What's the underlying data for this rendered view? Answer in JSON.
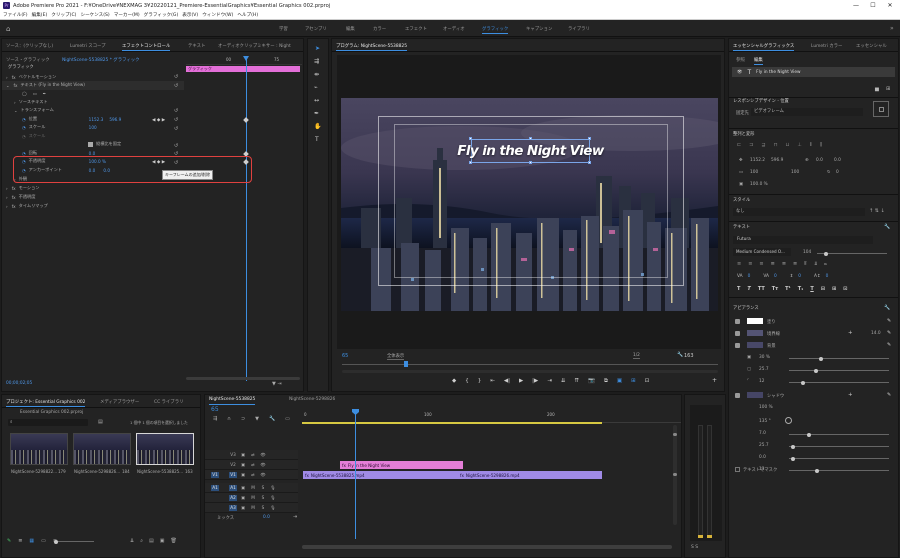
{
  "window": {
    "title": "Adobe Premiere Pro 2021 - F:¥OneDrive¥NEXMAG 3¥20220121_Premiere-EssentialGraphics¥Essential Graphics 002.prproj",
    "minimize": "—",
    "maximize": "☐",
    "close": "✕"
  },
  "menu": [
    "ファイル(F)",
    "編集(E)",
    "クリップ(C)",
    "シーケンス(S)",
    "マーカー(M)",
    "グラフィック(G)",
    "表示(V)",
    "ウィンドウ(W)",
    "ヘルプ(H)"
  ],
  "workspaces": {
    "items": [
      "学習",
      "アセンブリ",
      "編集",
      "カラー",
      "エフェクト",
      "オーディオ",
      "グラフィック",
      "キャプション",
      "ライブラリ"
    ],
    "active": "グラフィック"
  },
  "effectControls": {
    "tabs": [
      "ソース：(クリップなし)",
      "Lumetri スコープ",
      "エフェクトコントロール",
      "テキスト",
      "オーディオクリップミキサー : Night"
    ],
    "activeTab": "エフェクトコントロール",
    "master": "ソース・グラフィック",
    "sequence": "NightScene-5538825 * グラフィック",
    "header": "グラフィック",
    "ruler": [
      "00",
      "75"
    ],
    "clipBar": "グラフィック",
    "rows": [
      {
        "label": "ベクトルモーション",
        "indent": 1
      },
      {
        "label": "テキスト (Fly in the Night View)",
        "indent": 1
      },
      {
        "label": "ソーステキスト",
        "indent": 2
      },
      {
        "label": "トランスフォーム",
        "indent": 2
      },
      {
        "label": "位置",
        "v1": "1152.3",
        "v2": "596.9",
        "indent": 3
      },
      {
        "label": "スケール",
        "v1": "100",
        "v2": "",
        "indent": 3
      },
      {
        "label": "スケール",
        "v1": "",
        "v2": "",
        "indent": 3
      },
      {
        "label": "",
        "v1": "縦横比を固定",
        "v2": "",
        "indent": 3
      },
      {
        "label": "回転",
        "v1": "0.0",
        "v2": "",
        "indent": 3
      },
      {
        "label": "不透明度",
        "v1": "100.0 %",
        "v2": "",
        "indent": 3
      },
      {
        "label": "アンカーポイント",
        "v1": "0.0",
        "v2": "0.0",
        "indent": 3
      },
      {
        "label": "外観",
        "v1": "",
        "v2": "",
        "indent": 1
      },
      {
        "label": "モーション",
        "indent": 1
      },
      {
        "label": "不透明度",
        "indent": 1
      },
      {
        "label": "タイムリマップ",
        "indent": 1
      }
    ],
    "tooltip": "キーフレームの追加/削除",
    "timecode": "00;00;02;05"
  },
  "program": {
    "tabTitle": "プログラム: NightScene-5538825",
    "overlayTitle": "Fly in the Night View",
    "timecode": "65",
    "fit": "全体表示",
    "quality": "1/2",
    "duration": "163",
    "colors": {
      "sky": "#3c3a52",
      "title": "#ffffff"
    }
  },
  "essentialGraphics": {
    "tabs": [
      "エッセンシャルグラフィックス",
      "Lumetri カラー",
      "エッセンシャル"
    ],
    "subtabs": [
      "参照",
      "編集"
    ],
    "activeSub": "編集",
    "layer": "Fly in the Night View",
    "responsive": "レスポンシブデザイン - 位置",
    "pin": "固定先",
    "pinValue": "ビデオフレーム",
    "alignSection": "整列と変形",
    "pos": [
      "1152.2",
      "596.9"
    ],
    "anchor": [
      "0.0",
      "0.0"
    ],
    "scale": "100",
    "rot": "0",
    "opacity": "100.0 %",
    "styleLabel": "スタイル",
    "styleValue": "なし",
    "textLabel": "テキスト",
    "font": "Futura",
    "fontStyle": "Medium Condensed O...",
    "fontSize": "104",
    "tracking": [
      "0",
      "0",
      "0",
      "0"
    ],
    "appearance": "アピアランス",
    "fill": "塗り",
    "stroke": "境界線",
    "background": "背景",
    "shadow": "シャドウ",
    "strokeVal": "14.0",
    "bgVals": [
      "30 %",
      "25.7",
      "12"
    ],
    "shadowVals": [
      "135 °",
      "100 %",
      "7.0",
      "25.7",
      "0.0",
      "13"
    ],
    "textMask": "テキストでマスク"
  },
  "project": {
    "tabs": [
      "プロジェクト: Essential Graphics 002",
      "メディアブラウザー",
      "CC ライブラリ"
    ],
    "file": "Essential Graphics 002.prproj",
    "selection": "1 個中 1 個の項目を選択しました",
    "clips": [
      {
        "name": "NightScene-5298822...",
        "dur": "179"
      },
      {
        "name": "NightScene-5298826...",
        "dur": "184"
      },
      {
        "name": "NightScene-5538825...",
        "dur": "163"
      }
    ]
  },
  "timeline": {
    "tabs": [
      "NightScene-5538825",
      "NightScene-5298826"
    ],
    "timecode": "65",
    "ruler": [
      "0",
      "100",
      "200"
    ],
    "tracks": [
      {
        "name": "V3",
        "type": "video"
      },
      {
        "name": "V2",
        "type": "video"
      },
      {
        "name": "V1",
        "type": "video"
      },
      {
        "name": "A1",
        "type": "audio"
      },
      {
        "name": "A2",
        "type": "audio"
      },
      {
        "name": "A3",
        "type": "audio"
      }
    ],
    "mix": "ミックス",
    "mixVal": "0.0",
    "clips": [
      {
        "label": "Fly in the Night View",
        "track": "V2",
        "color": "#e26fd1"
      },
      {
        "label": "NightScene-5538825.mp4",
        "track": "V1",
        "color": "#9a7be4"
      },
      {
        "label": "NightScene-5298826.mp4",
        "track": "V1",
        "color": "#9a7be4"
      }
    ]
  }
}
